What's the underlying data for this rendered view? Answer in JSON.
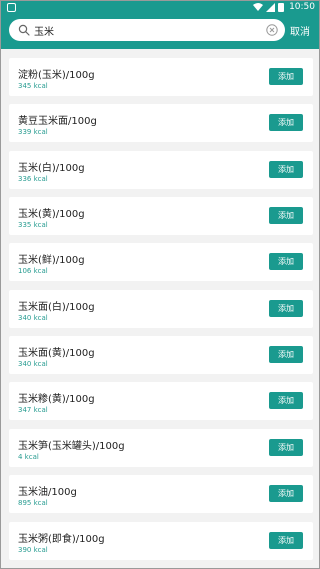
{
  "statusbar": {
    "time": "10:50"
  },
  "search": {
    "value": "玉米",
    "cancel_label": "取消"
  },
  "items": [
    {
      "name": "淀粉(玉米)/100g",
      "kcal": "345 kcal",
      "add_label": "添加"
    },
    {
      "name": "黄豆玉米面/100g",
      "kcal": "339 kcal",
      "add_label": "添加"
    },
    {
      "name": "玉米(白)/100g",
      "kcal": "336 kcal",
      "add_label": "添加"
    },
    {
      "name": "玉米(黄)/100g",
      "kcal": "335 kcal",
      "add_label": "添加"
    },
    {
      "name": "玉米(鲜)/100g",
      "kcal": "106 kcal",
      "add_label": "添加"
    },
    {
      "name": "玉米面(白)/100g",
      "kcal": "340 kcal",
      "add_label": "添加"
    },
    {
      "name": "玉米面(黄)/100g",
      "kcal": "340 kcal",
      "add_label": "添加"
    },
    {
      "name": "玉米糁(黄)/100g",
      "kcal": "347 kcal",
      "add_label": "添加"
    },
    {
      "name": "玉米笋(玉米罐头)/100g",
      "kcal": "4 kcal",
      "add_label": "添加"
    },
    {
      "name": "玉米油/100g",
      "kcal": "895 kcal",
      "add_label": "添加"
    },
    {
      "name": "玉米粥(即食)/100g",
      "kcal": "390 kcal",
      "add_label": "添加"
    }
  ]
}
